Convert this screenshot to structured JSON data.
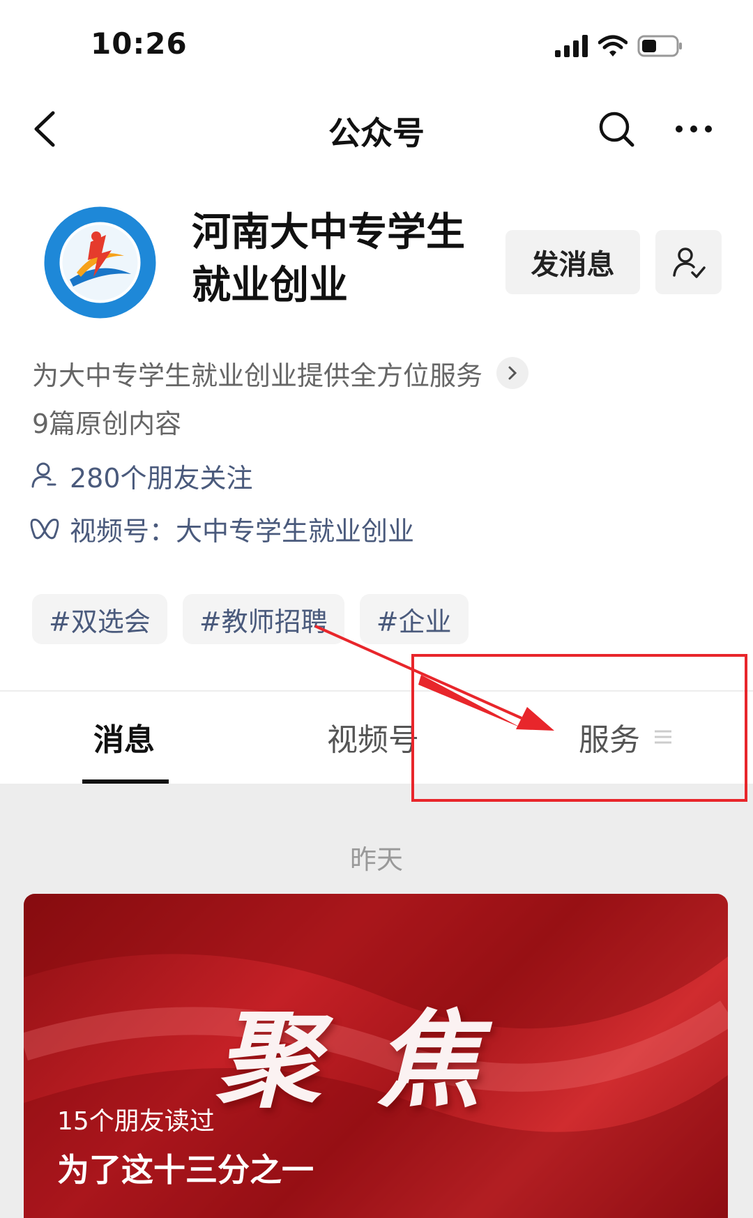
{
  "status_bar": {
    "time": "10:26",
    "icons": [
      "cellular-signal-icon",
      "wifi-icon",
      "battery-icon"
    ]
  },
  "nav": {
    "title": "公众号",
    "icons": [
      "back-arrow-icon",
      "search-icon",
      "more-icon"
    ]
  },
  "profile": {
    "name": "河南大中专学生就业创业",
    "message_button": "发消息",
    "description": "为大中专学生就业创业提供全方位服务",
    "original_count": "9篇原创内容",
    "friends_following": "280个朋友关注",
    "channel_label": "视频号：",
    "channel_name": "大中专学生就业创业"
  },
  "tags": [
    "#双选会",
    "#教师招聘",
    "#企业"
  ],
  "tabs": {
    "messages": "消息",
    "channels": "视频号",
    "services": "服务",
    "active": "消息"
  },
  "feed": {
    "date": "昨天",
    "article": {
      "cover_text": "聚焦",
      "read_count": "15个朋友读过",
      "title": "为了这十三分之一"
    }
  },
  "colors": {
    "accent_link": "#4a5a7c",
    "annotation": "#e8262b",
    "card_red": "#c42026"
  }
}
